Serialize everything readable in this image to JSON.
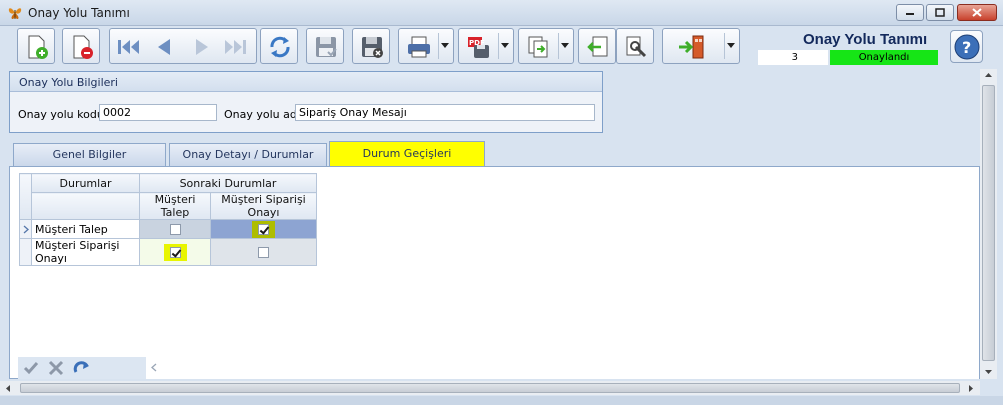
{
  "window": {
    "title": "Onay Yolu Tanımı"
  },
  "header": {
    "form_title": "Onay Yolu Tanımı",
    "code_value": "3",
    "status_text": "Onaylandı",
    "status_color": "#16e516"
  },
  "toolbar": {
    "buttons": [
      "new-document-icon",
      "delete-document-icon",
      "first-record-icon",
      "previous-record-icon",
      "next-record-icon",
      "last-record-icon",
      "refresh-icon",
      "save-icon",
      "cancel-save-icon",
      "print-icon",
      "pdf-export-icon",
      "copy-icon",
      "import-icon",
      "settings-icon",
      "exit-icon",
      "help-icon"
    ]
  },
  "info_panel": {
    "header": "Onay Yolu Bilgileri",
    "code_label": "Onay yolu kodu",
    "code_value": "0002",
    "name_label": "Onay yolu adı",
    "name_value": "Sipariş Onay Mesajı"
  },
  "tabs": [
    {
      "label": "Genel Bilgiler",
      "active": false
    },
    {
      "label": "Onay Detayı / Durumlar",
      "active": false
    },
    {
      "label": "Durum Geçişleri",
      "active": true
    }
  ],
  "grid": {
    "header_states": "Durumlar",
    "header_next": "Sonraki Durumlar",
    "columns": [
      "Müşteri Talep",
      "Müşteri Siparişi Onayı"
    ],
    "rows": [
      {
        "name": "Müşteri Talep",
        "values": [
          false,
          true
        ]
      },
      {
        "name": "Müşteri Siparişi Onayı",
        "values": [
          true,
          false
        ]
      }
    ]
  },
  "accent_color": "#ffff00"
}
